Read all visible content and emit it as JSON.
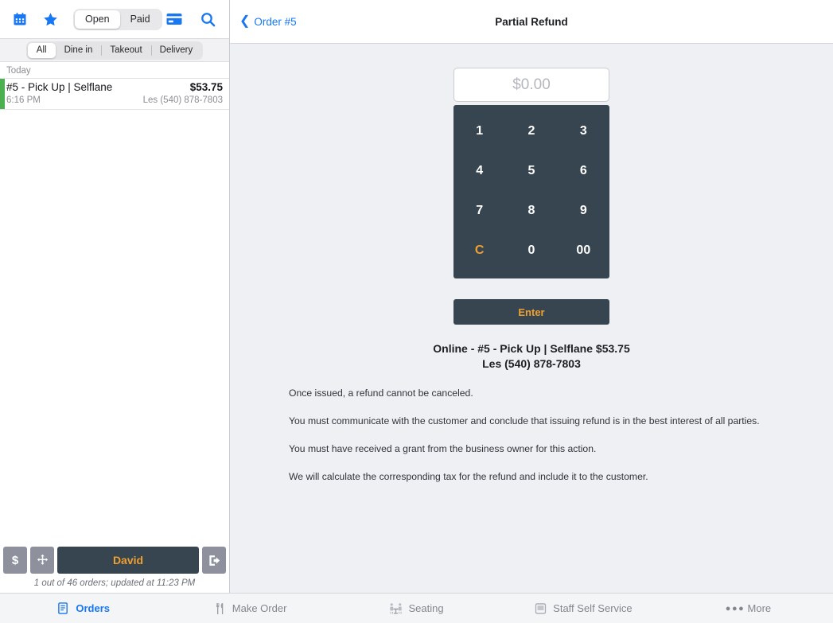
{
  "sidebar": {
    "header": {
      "calendar_icon": "calendar-icon",
      "star_icon": "star-icon",
      "card_icon": "credit-card-icon",
      "search_icon": "search-icon",
      "segments": [
        {
          "label": "Open",
          "active": true
        },
        {
          "label": "Paid",
          "active": false
        }
      ]
    },
    "filters": [
      {
        "label": "All",
        "active": true
      },
      {
        "label": "Dine in",
        "active": false
      },
      {
        "label": "Takeout",
        "active": false
      },
      {
        "label": "Delivery",
        "active": false
      }
    ],
    "day_label": "Today",
    "orders": [
      {
        "title": "#5 - Pick Up | Selflane",
        "amount": "$53.75",
        "time": "6:16 PM",
        "customer": "Les (540) 878-7803",
        "status_color": "#4caf50"
      }
    ],
    "bottom": {
      "cash_label": "$",
      "move_icon": "move-arrows-icon",
      "user_label": "David",
      "logout_icon": "logout-icon",
      "status_text": "1 out of 46 orders; updated at 11:23 PM"
    }
  },
  "main": {
    "back_label": "Order #5",
    "title": "Partial Refund",
    "amount_placeholder": "$0.00",
    "amount_value": "",
    "keypad": [
      "1",
      "2",
      "3",
      "4",
      "5",
      "6",
      "7",
      "8",
      "9",
      "C",
      "0",
      "00"
    ],
    "enter_label": "Enter",
    "summary_line1": "Online - #5 - Pick Up | Selflane $53.75",
    "summary_line2": "Les (540) 878-7803",
    "disclaimers": [
      "Once issued, a refund cannot be canceled.",
      "You must communicate with the customer and conclude that issuing refund is in the best interest of all parties.",
      "You must have received a grant from the business owner for this action.",
      "We will calculate the corresponding tax for the refund and include it to the customer."
    ]
  },
  "bottom_nav": [
    {
      "label": "Orders",
      "icon": "receipt-icon",
      "active": true
    },
    {
      "label": "Make Order",
      "icon": "cutlery-icon",
      "active": false
    },
    {
      "label": "Seating",
      "icon": "seating-icon",
      "active": false
    },
    {
      "label": "Staff Self Service",
      "icon": "monitor-icon",
      "active": false
    },
    {
      "label": "More",
      "icon": "ellipsis-icon",
      "active": false
    }
  ],
  "colors": {
    "accent_blue": "#1877f2",
    "accent_orange": "#f0a030",
    "keypad_dark": "#36454f",
    "status_green": "#4caf50",
    "panel_bg": "#eef0f3"
  }
}
